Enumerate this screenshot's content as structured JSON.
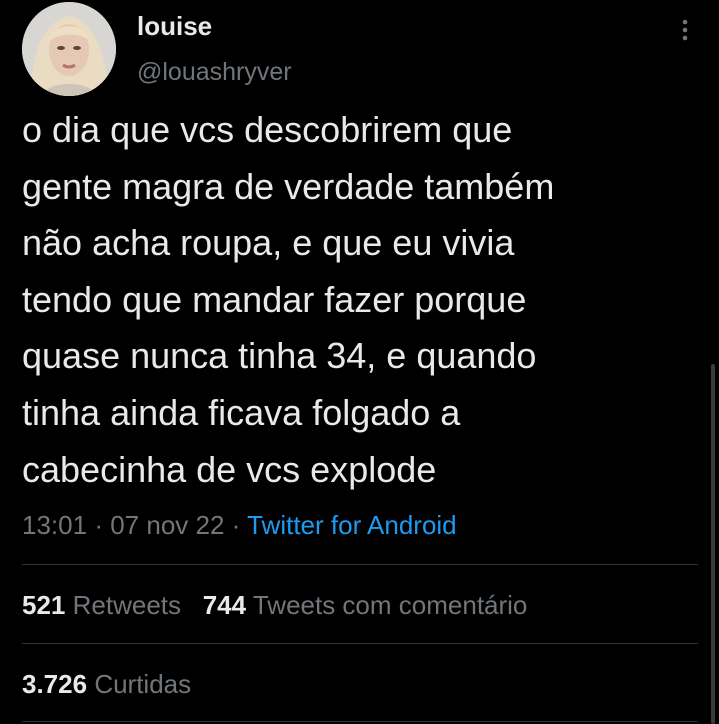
{
  "user": {
    "display_name": "louise",
    "handle": "@louashryver"
  },
  "tweet": {
    "text": "o dia que vcs descobrirem que\ngente magra de verdade também\nnão acha roupa, e que eu vivia\ntendo que mandar fazer porque\nquase nunca tinha 34, e quando\ntinha ainda ficava folgado a\ncabecinha de vcs explode",
    "time": "13:01",
    "date": "07 nov 22",
    "separator": "·",
    "source": "Twitter for Android"
  },
  "stats": {
    "retweets_count": "521",
    "retweets_label": "Retweets",
    "quotes_count": "744",
    "quotes_label": "Tweets com comentário",
    "likes_count": "3.726",
    "likes_label": "Curtidas"
  },
  "icons": {
    "more": "more-vertical-icon"
  },
  "colors": {
    "background": "#000000",
    "primary_text": "#e7e9ea",
    "secondary_text": "#71767b",
    "accent": "#1d9bf0",
    "divider": "#2f3336"
  }
}
